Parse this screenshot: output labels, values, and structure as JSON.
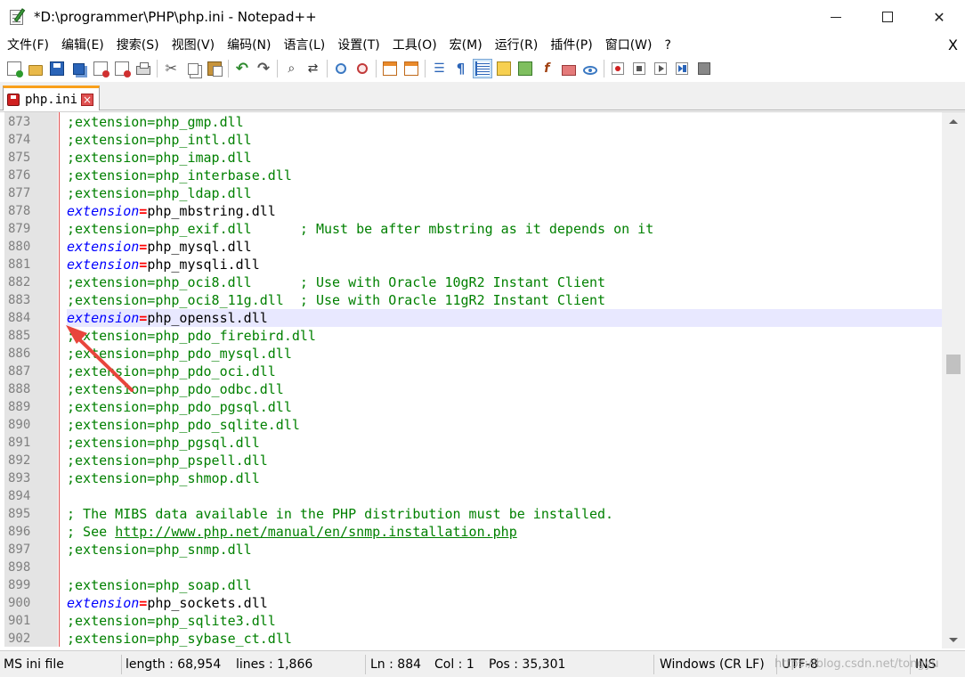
{
  "window": {
    "title": "*D:\\programmer\\PHP\\php.ini - Notepad++",
    "min_label": "",
    "close_label": "✕"
  },
  "menu": {
    "items": [
      "文件(F)",
      "编辑(E)",
      "搜索(S)",
      "视图(V)",
      "编码(N)",
      "语言(L)",
      "设置(T)",
      "工具(O)",
      "宏(M)",
      "运行(R)",
      "插件(P)",
      "窗口(W)",
      "?"
    ],
    "close": "X"
  },
  "toolbar": {
    "icons": [
      "new-file-icon",
      "open-file-icon",
      "save-icon",
      "save-all-icon",
      "close-icon",
      "close-all-icon",
      "print-icon",
      "cut-icon",
      "copy-icon",
      "paste-icon",
      "undo-icon",
      "redo-icon",
      "find-icon",
      "replace-icon",
      "zoom-in-icon",
      "zoom-out-icon",
      "sync-vertical-icon",
      "sync-horizontal-icon",
      "word-wrap-icon",
      "show-all-characters-icon",
      "indent-guide-icon",
      "user-language-icon",
      "document-map-icon",
      "function-list-icon",
      "folder-as-workspace-icon",
      "monitoring-icon",
      "record-macro-icon",
      "stop-macro-icon",
      "play-macro-icon",
      "run-macro-multiple-icon",
      "save-macro-icon"
    ]
  },
  "tab": {
    "label": "php.ini",
    "close": "×"
  },
  "editor": {
    "lines": [
      {
        "n": "873",
        "code": ";extension=php_gmp.dll"
      },
      {
        "n": "874",
        "code": ";extension=php_intl.dll"
      },
      {
        "n": "875",
        "code": ";extension=php_imap.dll"
      },
      {
        "n": "876",
        "code": ";extension=php_interbase.dll"
      },
      {
        "n": "877",
        "code": ";extension=php_ldap.dll"
      },
      {
        "n": "878",
        "key": "extension",
        "op": "=",
        "val": "php_mbstring.dll"
      },
      {
        "n": "879",
        "code": ";extension=php_exif.dll      ; Must be after mbstring as it depends on it"
      },
      {
        "n": "880",
        "key": "extension",
        "op": "=",
        "val": "php_mysql.dll"
      },
      {
        "n": "881",
        "key": "extension",
        "op": "=",
        "val": "php_mysqli.dll"
      },
      {
        "n": "882",
        "code": ";extension=php_oci8.dll      ; Use with Oracle 10gR2 Instant Client"
      },
      {
        "n": "883",
        "code": ";extension=php_oci8_11g.dll  ; Use with Oracle 11gR2 Instant Client"
      },
      {
        "n": "884",
        "key": "extension",
        "op": "=",
        "val": "php_openssl.dll",
        "current": true
      },
      {
        "n": "885",
        "code": ";extension=php_pdo_firebird.dll"
      },
      {
        "n": "886",
        "code": ";extension=php_pdo_mysql.dll"
      },
      {
        "n": "887",
        "code": ";extension=php_pdo_oci.dll"
      },
      {
        "n": "888",
        "code": ";extension=php_pdo_odbc.dll"
      },
      {
        "n": "889",
        "code": ";extension=php_pdo_pgsql.dll"
      },
      {
        "n": "890",
        "code": ";extension=php_pdo_sqlite.dll"
      },
      {
        "n": "891",
        "code": ";extension=php_pgsql.dll"
      },
      {
        "n": "892",
        "code": ";extension=php_pspell.dll"
      },
      {
        "n": "893",
        "code": ";extension=php_shmop.dll"
      },
      {
        "n": "894",
        "code": ""
      },
      {
        "n": "895",
        "code": "; The MIBS data available in the PHP distribution must be installed."
      },
      {
        "n": "896",
        "code": "; See ",
        "link": "http://www.php.net/manual/en/snmp.installation.php"
      },
      {
        "n": "897",
        "code": ";extension=php_snmp.dll"
      },
      {
        "n": "898",
        "code": ""
      },
      {
        "n": "899",
        "code": ";extension=php_soap.dll"
      },
      {
        "n": "900",
        "key": "extension",
        "op": "=",
        "val": "php_sockets.dll"
      },
      {
        "n": "901",
        "code": ";extension=php_sqlite3.dll"
      },
      {
        "n": "902",
        "code": ";extension=php_sybase_ct.dll"
      }
    ]
  },
  "colors": {
    "comment": "#008000",
    "key": "#0000ff",
    "operator": "#ff0000",
    "current_line": "#e8e8ff",
    "annotation_arrow": "#e8453c"
  },
  "statusbar": {
    "filetype": "MS ini file",
    "length": "length : 68,954",
    "lines": "lines : 1,866",
    "ln": "Ln : 884",
    "col": "Col : 1",
    "pos": "Pos : 35,301",
    "eol": "Windows (CR LF)",
    "encoding": "UTF-8",
    "mode": "INS",
    "watermark": "https://blog.csdn.net/tongyu"
  }
}
